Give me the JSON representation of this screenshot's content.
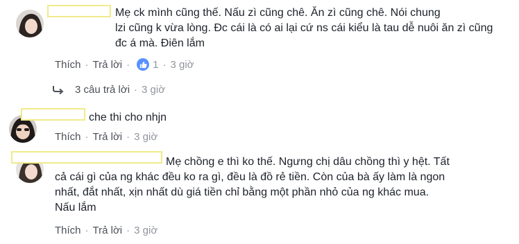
{
  "comments": [
    {
      "text": "Mẹ ck mình cũng thế. Nấu zì cũng chê. Ăn zì cũng chê. Nói chung\nlzi cũng k vừa lòng. Đc cái là có ai lại cứ ns cái kiểu là tau dễ nuôi ăn zì cũng\nđc á mà. Điên lắm",
      "like_label": "Thích",
      "reply_label": "Trả lời",
      "like_count": "1",
      "time": "3 giờ"
    },
    {
      "text": "che thi cho nhjn",
      "like_label": "Thích",
      "reply_label": "Trả lời",
      "time": "3 giờ"
    },
    {
      "text": "Mẹ chồng e thì ko thế. Ngưng chị dâu chồng thì y hệt. Tất\ncả cái gì của ng khác đều ko ra gì, đều là đồ rẻ tiền. Còn của bà ấy làm là ngon\nnhất, đắt nhất, xịn nhất dù giá tiền chỉ bằng một phần nhỏ của ng khác mua.\nNấu lắm",
      "like_label": "Thích",
      "reply_label": "Trả lời",
      "time": "3 giờ"
    }
  ],
  "replies_link": {
    "label": "3 câu trả lời",
    "time": "3 giờ"
  },
  "colors": {
    "meta_text": "#90949c",
    "action_text": "#4b4f56",
    "like_badge": "#5890ff",
    "name_box_border": "#f0eb8a"
  },
  "icons": {
    "like": "thumbs-up-icon",
    "reply_arrow": "reply-arrow-icon"
  }
}
